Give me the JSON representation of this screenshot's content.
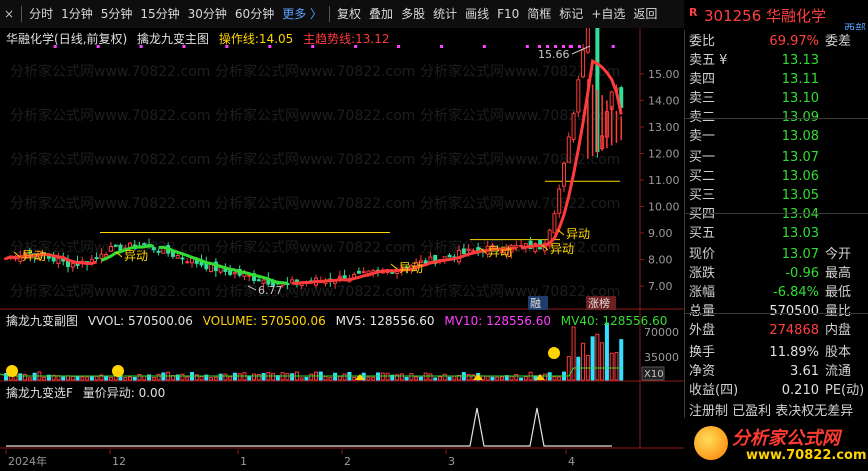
{
  "toolbar": {
    "close_icon": "×",
    "items": [
      "分时",
      "1分钟",
      "5分钟",
      "15分钟",
      "30分钟",
      "60分钟"
    ],
    "more": "更多 〉",
    "items2": [
      "复权",
      "叠加",
      "多股",
      "统计",
      "画线",
      "F10",
      "简框",
      "标记",
      "+自选",
      "返回"
    ]
  },
  "stock": {
    "marker": "R",
    "code": "301256",
    "name": "华融化学",
    "exchange_tag": "西部"
  },
  "main_panel": {
    "name": "华融化学",
    "mode": "(日线,前复权)",
    "indicator": "擒龙九变主图",
    "op_label": "操作线:",
    "op_value": "14.05",
    "trend_label": "主趋势线:",
    "trend_value": "13.12",
    "high_label": "15.66",
    "low_label": "6.77",
    "signal": "异动",
    "y_ticks": [
      "15.00",
      "14.00",
      "13.00",
      "12.00",
      "11.00",
      "10.00",
      "9.00",
      "8.00",
      "7.00"
    ],
    "badges": [
      "融",
      "涨榜"
    ]
  },
  "sub_panel": {
    "indicator": "擒龙九变副图",
    "vvol": "VVOL: 570500.06",
    "volume": "VOLUME: 570500.06",
    "mv5": "MV5: 128556.60",
    "mv10": "MV10: 128556.60",
    "mv40": "MV40: 128556.60",
    "y_ticks": [
      "70000",
      "35000"
    ],
    "unit": "X10"
  },
  "sub2_panel": {
    "indicator": "擒龙九变选F",
    "field": "量价异动: 0.00"
  },
  "date_axis": {
    "labels": [
      "2024年",
      "12",
      "1",
      "2",
      "3",
      "4"
    ]
  },
  "watermark": "分析家公式网www.70822.com",
  "quote": {
    "weibi": {
      "label": "委比",
      "value": "69.97%",
      "right": "委差"
    },
    "sells": [
      {
        "label": "卖五 ¥",
        "price": "13.13"
      },
      {
        "label": "卖四",
        "price": "13.11"
      },
      {
        "label": "卖三",
        "price": "13.10"
      },
      {
        "label": "卖二",
        "price": "13.09"
      },
      {
        "label": "卖一",
        "price": "13.08"
      }
    ],
    "buys": [
      {
        "label": "买一",
        "price": "13.07"
      },
      {
        "label": "买二",
        "price": "13.06"
      },
      {
        "label": "买三",
        "price": "13.05"
      },
      {
        "label": "买四",
        "price": "13.04"
      },
      {
        "label": "买五",
        "price": "13.03"
      }
    ],
    "stats": [
      {
        "label": "现价",
        "value": "13.07",
        "right": "今开",
        "color": "#33dd33"
      },
      {
        "label": "涨跌",
        "value": "-0.96",
        "right": "最高",
        "color": "#33dd33"
      },
      {
        "label": "涨幅",
        "value": "-6.84%",
        "right": "最低",
        "color": "#33dd33"
      },
      {
        "label": "总量",
        "value": "570500",
        "right": "量比",
        "color": "#e8e8e8"
      },
      {
        "label": "外盘",
        "value": "274868",
        "right": "内盘",
        "color": "#ff4040"
      }
    ],
    "stats2": [
      {
        "label": "换手",
        "value": "11.89%",
        "right": "股本"
      },
      {
        "label": "净资",
        "value": "3.61",
        "right": "流通"
      },
      {
        "label": "收益(四)",
        "value": "0.210",
        "right": "PE(动)"
      }
    ],
    "ticker": "注册制 已盈利 表决权无差异"
  },
  "logo": {
    "text": "分析家公式网",
    "url": "www.70822.com"
  },
  "colors": {
    "up": "#ff3b3b",
    "down": "#33dd33",
    "accent": "#ffd400",
    "blue": "#4fa0ff"
  }
}
